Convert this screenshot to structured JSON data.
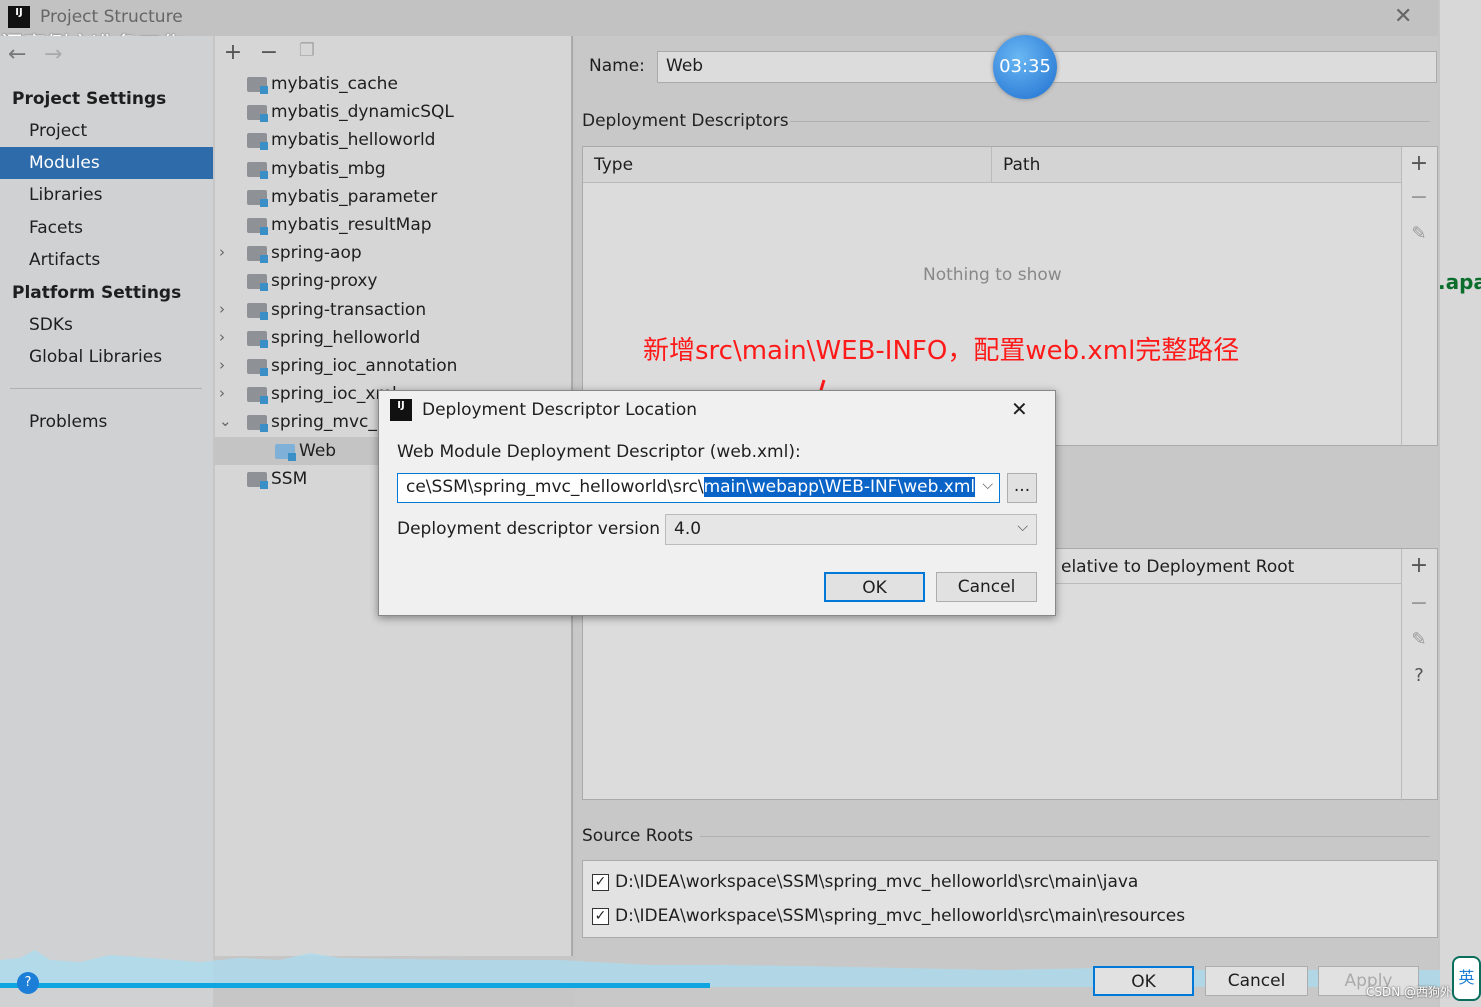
{
  "window": {
    "title": "Project Structure",
    "close_icon": "close-icon"
  },
  "overlay": {
    "video_caption": "门案例之准备工作",
    "timer": "03:35",
    "watermark": "CSDN @西狗外",
    "annotation": "新增src\\main\\WEB-INFO，配置web.xml完整路径",
    "side_text": ".apa",
    "ime": "英"
  },
  "sidebar": {
    "project_settings": "Project Settings",
    "items": [
      {
        "label": "Project"
      },
      {
        "label": "Modules"
      },
      {
        "label": "Libraries"
      },
      {
        "label": "Facets"
      },
      {
        "label": "Artifacts"
      }
    ],
    "platform_settings": "Platform Settings",
    "platform_items": [
      {
        "label": "SDKs"
      },
      {
        "label": "Global Libraries"
      }
    ],
    "problems": "Problems",
    "selected": "Modules"
  },
  "tree": {
    "items": [
      {
        "label": "mybatis_cache",
        "expandable": false
      },
      {
        "label": "mybatis_dynamicSQL",
        "expandable": false
      },
      {
        "label": "mybatis_helloworld",
        "expandable": false
      },
      {
        "label": "mybatis_mbg",
        "expandable": false
      },
      {
        "label": "mybatis_parameter",
        "expandable": false
      },
      {
        "label": "mybatis_resultMap",
        "expandable": false
      },
      {
        "label": "spring-aop",
        "expandable": true
      },
      {
        "label": "spring-proxy",
        "expandable": false
      },
      {
        "label": "spring-transaction",
        "expandable": true
      },
      {
        "label": "spring_helloworld",
        "expandable": true
      },
      {
        "label": "spring_ioc_annotation",
        "expandable": true
      },
      {
        "label": "spring_ioc_xml",
        "expandable": true
      },
      {
        "label": "spring_mvc_helloworld",
        "expandable": true,
        "expanded": true
      },
      {
        "label": "Web",
        "child": true,
        "selected": true
      },
      {
        "label": "SSM",
        "expandable": false
      }
    ]
  },
  "facet": {
    "name_label": "Name:",
    "name_value": "Web",
    "deployment_descriptors": "Deployment Descriptors",
    "columns": [
      "Type",
      "Path"
    ],
    "empty": "Nothing to show",
    "resource_col": "elative to Deployment Root",
    "source_roots": "Source Roots",
    "roots": [
      {
        "path": "D:\\IDEA\\workspace\\SSM\\spring_mvc_helloworld\\src\\main\\java",
        "checked": true
      },
      {
        "path": "D:\\IDEA\\workspace\\SSM\\spring_mvc_helloworld\\src\\main\\resources",
        "checked": true
      }
    ]
  },
  "footer": {
    "ok": "OK",
    "cancel": "Cancel",
    "apply": "Apply"
  },
  "dialog": {
    "title": "Deployment Descriptor Location",
    "field_label": "Web Module Deployment Descriptor (web.xml):",
    "path_plain": "ce\\SSM\\spring_mvc_helloworld\\src\\",
    "path_selected": "main\\webapp\\WEB-INF\\web.xml",
    "browse": "...",
    "version_label": "Deployment descriptor version",
    "version_value": "4.0",
    "ok": "OK",
    "cancel": "Cancel"
  },
  "colors": {
    "selection": "#2e6bab",
    "annotation": "#ff1a1a",
    "progress": "#0ea5e0"
  }
}
